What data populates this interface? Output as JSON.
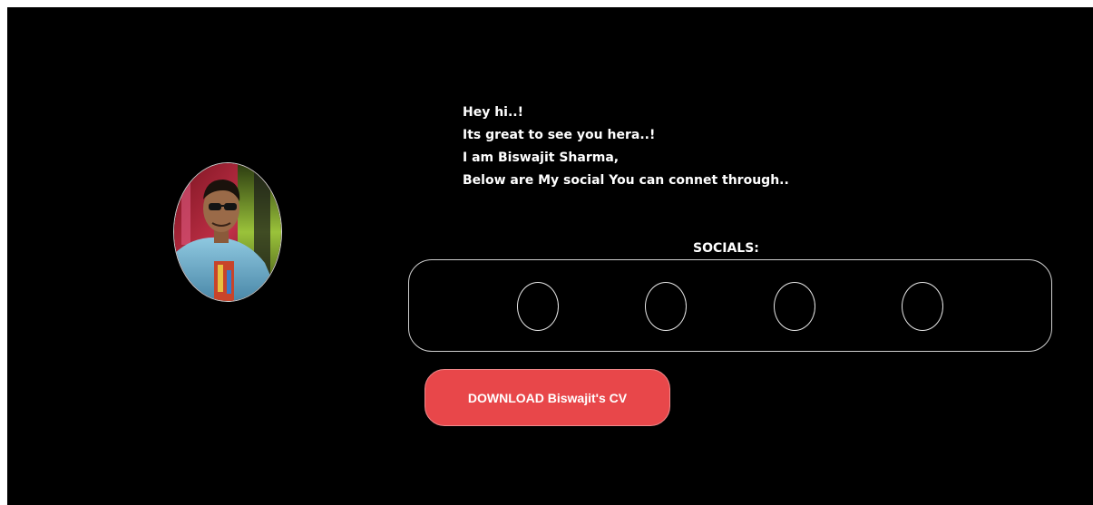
{
  "profile": {
    "photo_icon": "profile-photo"
  },
  "intro": {
    "line1": "Hey hi..!",
    "line2": "Its great to see you hera..!",
    "line3": "I am Biswajit Sharma,",
    "line4": "Below are My social You can connet through.."
  },
  "socials": {
    "title": "SOCIALS:",
    "count": 4
  },
  "download": {
    "label": "DOWNLOAD Biswajit's CV"
  },
  "colors": {
    "background": "#000000",
    "button": "#e8474a",
    "text": "#ffffff",
    "outline": "#cfcfcf"
  }
}
